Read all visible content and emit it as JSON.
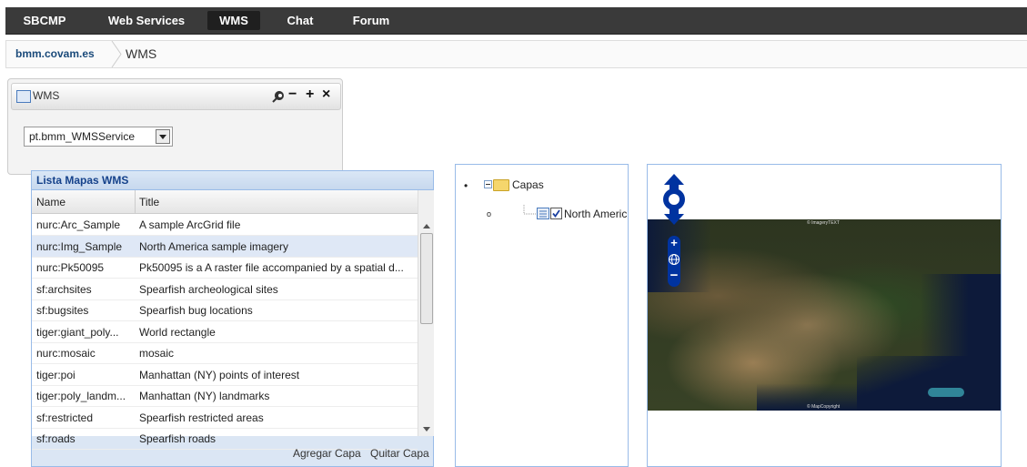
{
  "topnav": {
    "items": [
      {
        "label": "SBCMP"
      },
      {
        "label": "Web Services"
      },
      {
        "label": "WMS"
      },
      {
        "label": "Chat"
      },
      {
        "label": "Forum"
      }
    ],
    "active": "WMS"
  },
  "breadcrumb": {
    "site": "bmm.covam.es",
    "current": "WMS"
  },
  "wms_panel": {
    "title": "WMS",
    "select_value": "pt.bmm_WMSService"
  },
  "list_panel": {
    "title": "Lista Mapas WMS",
    "columns": [
      "Name",
      "Title"
    ],
    "rows": [
      {
        "name": "nurc:Arc_Sample",
        "title": "A sample ArcGrid file"
      },
      {
        "name": "nurc:Img_Sample",
        "title": "North America sample imagery"
      },
      {
        "name": "nurc:Pk50095",
        "title": "Pk50095 is a A raster file accompanied by a spatial d..."
      },
      {
        "name": "sf:archsites",
        "title": "Spearfish archeological sites"
      },
      {
        "name": "sf:bugsites",
        "title": "Spearfish bug locations"
      },
      {
        "name": "tiger:giant_poly...",
        "title": "World rectangle"
      },
      {
        "name": "nurc:mosaic",
        "title": "mosaic"
      },
      {
        "name": "tiger:poi",
        "title": "Manhattan (NY) points of interest"
      },
      {
        "name": "tiger:poly_landm...",
        "title": "Manhattan (NY) landmarks"
      },
      {
        "name": "sf:restricted",
        "title": "Spearfish restricted areas"
      },
      {
        "name": "sf:roads",
        "title": "Spearfish roads"
      }
    ],
    "selected_index": 1,
    "add_button": "Agregar Capa",
    "remove_button": "Quitar Capa"
  },
  "tree": {
    "root": "Capas",
    "layer": "North Americ",
    "layer_checked": true
  },
  "map": {
    "top_label": "© ImageryTEXT",
    "bottom_label": "© MapCopyright"
  }
}
